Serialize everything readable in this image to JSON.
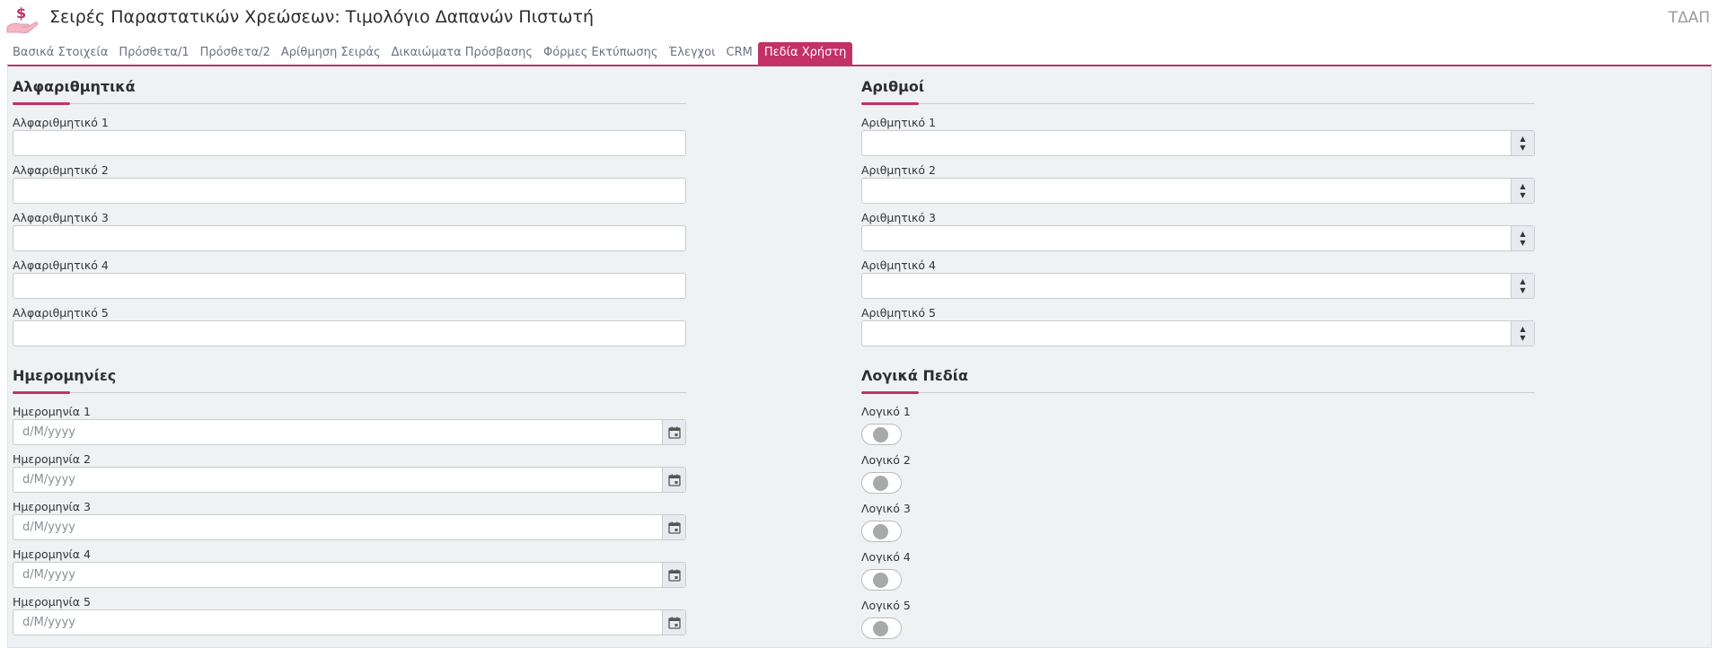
{
  "header": {
    "title": "Σειρές Παραστατικών Χρεώσεων: Τιμολόγιο Δαπανών Πιστωτή",
    "company_code": "ΤΔΑΠ",
    "icon": "hand-dollar-icon"
  },
  "tabs": [
    {
      "label": "Βασικά Στοιχεία",
      "active": false
    },
    {
      "label": "Πρόσθετα/1",
      "active": false
    },
    {
      "label": "Πρόσθετα/2",
      "active": false
    },
    {
      "label": "Αρίθμηση Σειράς",
      "active": false
    },
    {
      "label": "Δικαιώματα Πρόσβασης",
      "active": false
    },
    {
      "label": "Φόρμες Εκτύπωσης",
      "active": false
    },
    {
      "label": "Έλεγχοι",
      "active": false
    },
    {
      "label": "CRM",
      "active": false
    },
    {
      "label": "Πεδία Χρήστη",
      "active": true
    }
  ],
  "sections": {
    "alphanumeric": {
      "title": "Αλφαριθμητικά",
      "fields": [
        "Αλφαριθμητικό 1",
        "Αλφαριθμητικό 2",
        "Αλφαριθμητικό 3",
        "Αλφαριθμητικό 4",
        "Αλφαριθμητικό 5"
      ]
    },
    "numbers": {
      "title": "Αριθμοί",
      "fields": [
        "Αριθμητικό 1",
        "Αριθμητικό 2",
        "Αριθμητικό 3",
        "Αριθμητικό 4",
        "Αριθμητικό 5"
      ]
    },
    "dates": {
      "title": "Ημερομηνίες",
      "placeholder": "d/M/yyyy",
      "fields": [
        "Ημερομηνία 1",
        "Ημερομηνία 2",
        "Ημερομηνία 3",
        "Ημερομηνία 4",
        "Ημερομηνία 5"
      ]
    },
    "booleans": {
      "title": "Λογικά Πεδία",
      "fields": [
        "Λογικό 1",
        "Λογικό 2",
        "Λογικό 3",
        "Λογικό 4",
        "Λογικό 5"
      ]
    }
  },
  "colors": {
    "accent": "#c23266",
    "panel_bg": "#eff2f3"
  }
}
